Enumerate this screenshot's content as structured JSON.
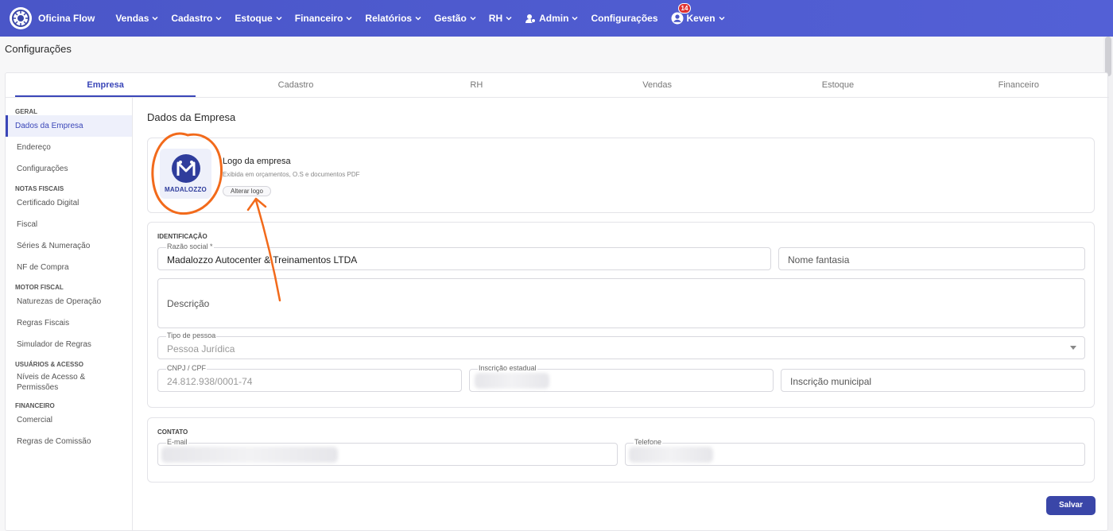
{
  "app": {
    "name": "Oficina Flow"
  },
  "nav": {
    "items": [
      {
        "label": "Vendas"
      },
      {
        "label": "Cadastro"
      },
      {
        "label": "Estoque"
      },
      {
        "label": "Financeiro"
      },
      {
        "label": "Relatórios"
      },
      {
        "label": "Gestão"
      },
      {
        "label": "RH"
      },
      {
        "label": "Admin"
      },
      {
        "label": "Configurações"
      }
    ],
    "user": {
      "name": "Keven",
      "notifications": "14"
    }
  },
  "page": {
    "title": "Configurações"
  },
  "tabs": [
    "Empresa",
    "Cadastro",
    "RH",
    "Vendas",
    "Estoque",
    "Financeiro"
  ],
  "sidebar": {
    "sections": [
      {
        "title": "GERAL",
        "items": [
          "Dados da Empresa",
          "Endereço",
          "Configurações"
        ]
      },
      {
        "title": "NOTAS FISCAIS",
        "items": [
          "Certificado Digital",
          "Fiscal",
          "Séries & Numeração",
          "NF de Compra"
        ]
      },
      {
        "title": "MOTOR FISCAL",
        "items": [
          "Naturezas de Operação",
          "Regras Fiscais",
          "Simulador de Regras"
        ]
      },
      {
        "title": "USUÁRIOS & ACESSO",
        "items": [
          "Níveis de Acesso & Permissões"
        ]
      },
      {
        "title": "FINANCEIRO",
        "items": [
          "Comercial",
          "Regras de Comissão"
        ]
      }
    ]
  },
  "content": {
    "title": "Dados da Empresa",
    "logo": {
      "brand_text": "MADALOZZO",
      "heading": "Logo da empresa",
      "subtitle": "Exibida em orçamentos, O.S e documentos PDF",
      "button": "Alterar logo"
    },
    "identification": {
      "section": "IDENTIFICAÇÃO",
      "razao_label": "Razão social *",
      "razao_value": "Madalozzo Autocenter & Treinamentos LTDA",
      "fantasia_placeholder": "Nome fantasia",
      "descricao_placeholder": "Descrição",
      "tipo_label": "Tipo de pessoa",
      "tipo_value": "Pessoa Jurídica",
      "cnpj_label": "CNPJ / CPF",
      "cnpj_value": "24.812.938/0001-74",
      "ie_label": "Inscrição estadual",
      "im_placeholder": "Inscrição municipal"
    },
    "contact": {
      "section": "CONTATO",
      "email_label": "E-mail",
      "phone_label": "Telefone"
    },
    "save": "Salvar"
  },
  "colors": {
    "primary": "#4a56c8",
    "annotation": "#f26a1b",
    "badge": "#e03131"
  }
}
